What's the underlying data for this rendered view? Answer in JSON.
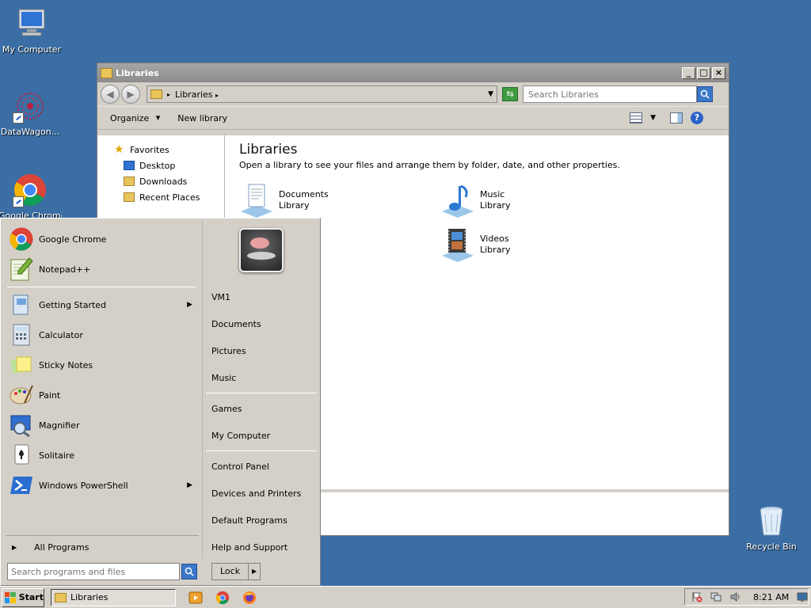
{
  "desktop": {
    "icons": [
      {
        "label": "My Computer",
        "icon": "computer-icon"
      },
      {
        "label": "DataWagon...",
        "icon": "datawagon-icon"
      },
      {
        "label": "Google Chrome",
        "icon": "chrome-icon"
      },
      {
        "label": "Recycle Bin",
        "icon": "recycle-bin-icon"
      }
    ]
  },
  "window": {
    "title": "Libraries",
    "address": "Libraries",
    "search_placeholder": "Search Libraries",
    "toolbar": {
      "organize": "Organize",
      "new_library": "New library"
    },
    "nav": {
      "favorites": "Favorites",
      "items": [
        "Desktop",
        "Downloads",
        "Recent Places"
      ]
    },
    "main": {
      "heading": "Libraries",
      "subtitle": "Open a library to see your files and arrange them by folder, date, and other properties.",
      "libraries": [
        {
          "name": "Documents",
          "type": "Library",
          "icon": "documents-library-icon"
        },
        {
          "name": "Music",
          "type": "Library",
          "icon": "music-library-icon"
        },
        {
          "name": "Videos",
          "type": "Library",
          "icon": "videos-library-icon"
        }
      ]
    }
  },
  "start_menu": {
    "pinned": [
      {
        "label": "Google Chrome",
        "icon": "chrome-icon"
      },
      {
        "label": "Notepad++",
        "icon": "notepadpp-icon"
      }
    ],
    "recent": [
      {
        "label": "Getting Started",
        "icon": "getting-started-icon",
        "submenu": true
      },
      {
        "label": "Calculator",
        "icon": "calculator-icon",
        "submenu": false
      },
      {
        "label": "Sticky Notes",
        "icon": "sticky-notes-icon",
        "submenu": false
      },
      {
        "label": "Paint",
        "icon": "paint-icon",
        "submenu": false
      },
      {
        "label": "Magnifier",
        "icon": "magnifier-icon",
        "submenu": false
      },
      {
        "label": "Solitaire",
        "icon": "solitaire-icon",
        "submenu": false
      },
      {
        "label": "Windows PowerShell",
        "icon": "powershell-icon",
        "submenu": true
      }
    ],
    "all_programs": "All Programs",
    "search_placeholder": "Search programs and files",
    "lock": "Lock",
    "right_group1": [
      "VM1",
      "Documents",
      "Pictures",
      "Music"
    ],
    "right_group2": [
      "Games",
      "My Computer"
    ],
    "right_group3": [
      "Control Panel",
      "Devices and Printers",
      "Default Programs",
      "Help and Support"
    ]
  },
  "taskbar": {
    "start": "Start",
    "active_task": "Libraries",
    "clock": "8:21 AM"
  }
}
